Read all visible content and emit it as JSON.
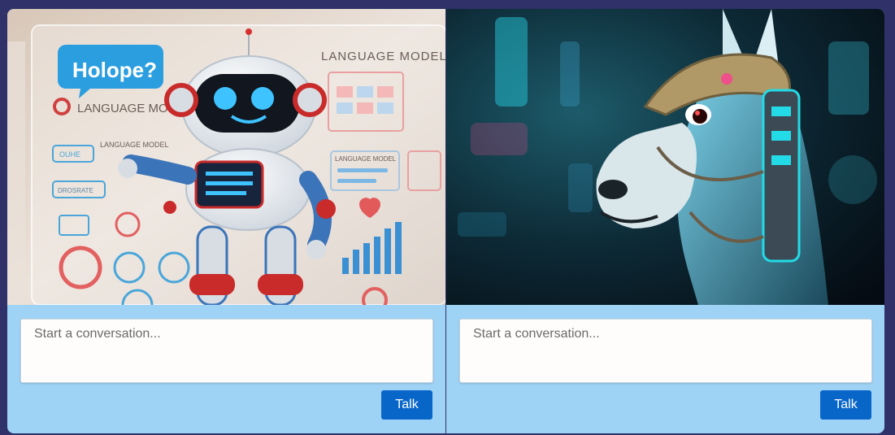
{
  "panels": [
    {
      "image": {
        "bubble_text": "Holope?",
        "heading": "LANGUAGE MODEL",
        "label_main": "LANGUAGE MODEL",
        "label_small": "LANGUAGE MODEL",
        "label_right": "LANGUAGE MODEL",
        "chip_one": "OUHE",
        "chip_two": "DROSRATE"
      },
      "input": {
        "placeholder": "Start a conversation..."
      },
      "talk_label": "Talk"
    },
    {
      "image": {},
      "input": {
        "placeholder": "Start a conversation..."
      },
      "talk_label": "Talk"
    }
  ]
}
